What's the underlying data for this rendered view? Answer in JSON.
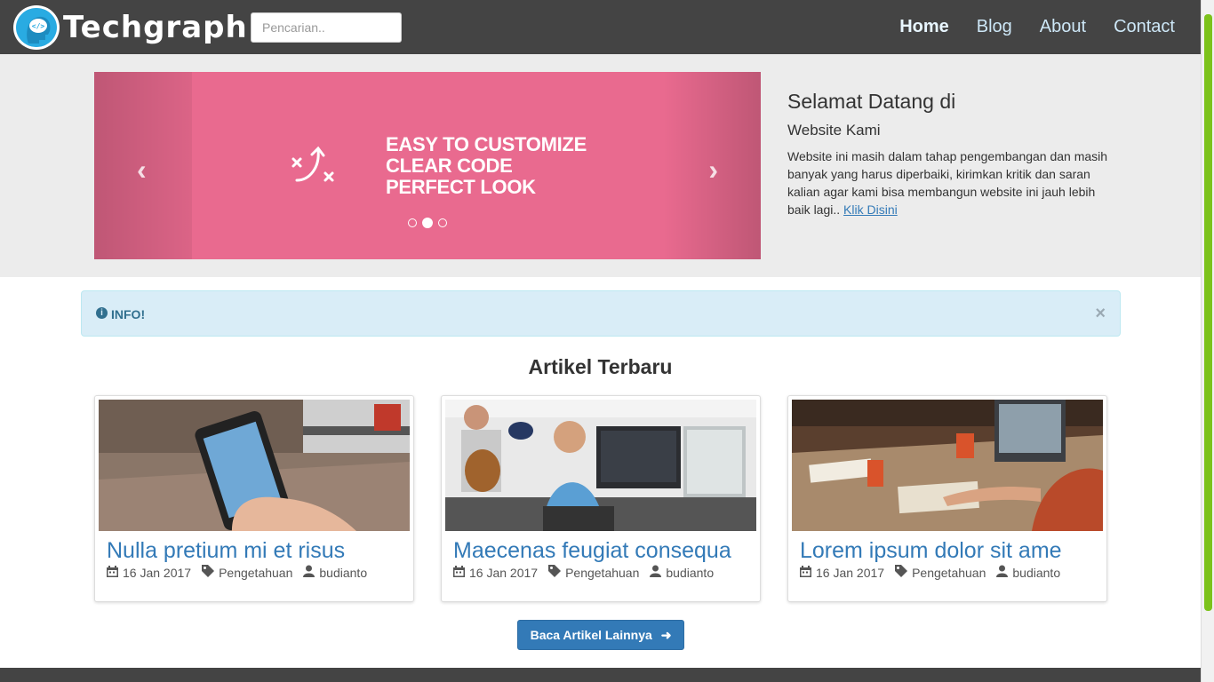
{
  "header": {
    "logo_text": "Techgraph",
    "logo_icon": "code-head-icon",
    "search_placeholder": "Pencarian..",
    "nav": [
      {
        "label": "Home",
        "active": true
      },
      {
        "label": "Blog"
      },
      {
        "label": "About"
      },
      {
        "label": "Contact"
      }
    ]
  },
  "hero": {
    "slide_lines": [
      "EASY TO CUSTOMIZE",
      "CLEAR CODE",
      "PERFECT LOOK"
    ],
    "slide_color": "#e96a8f",
    "active_slide": 2,
    "slide_count": 3,
    "welcome_title": "Selamat Datang di",
    "welcome_subtitle": "Website Kami",
    "welcome_text": "Website ini masih dalam tahap pengembangan dan masih banyak yang harus diperbaiki, kirimkan kritik dan saran kalian agar kami bisa membangun website ini jauh lebih baik lagi.. ",
    "welcome_link": "Klik Disini"
  },
  "alert": {
    "label": "INFO!",
    "close": "×"
  },
  "section_title": "Artikel Terbaru",
  "articles": [
    {
      "title": "Nulla pretium mi et risus",
      "date": "16 Jan 2017",
      "category": "Pengetahuan",
      "author": "budianto"
    },
    {
      "title": "Maecenas feugiat consequa",
      "date": "16 Jan 2017",
      "category": "Pengetahuan",
      "author": "budianto"
    },
    {
      "title": "Lorem ipsum dolor sit ame",
      "date": "16 Jan 2017",
      "category": "Pengetahuan",
      "author": "budianto"
    }
  ],
  "more_button": "Baca Artikel Lainnya",
  "colors": {
    "navbar": "#444444",
    "accent": "#337ab7",
    "scrollbar": "#7cc21b"
  }
}
